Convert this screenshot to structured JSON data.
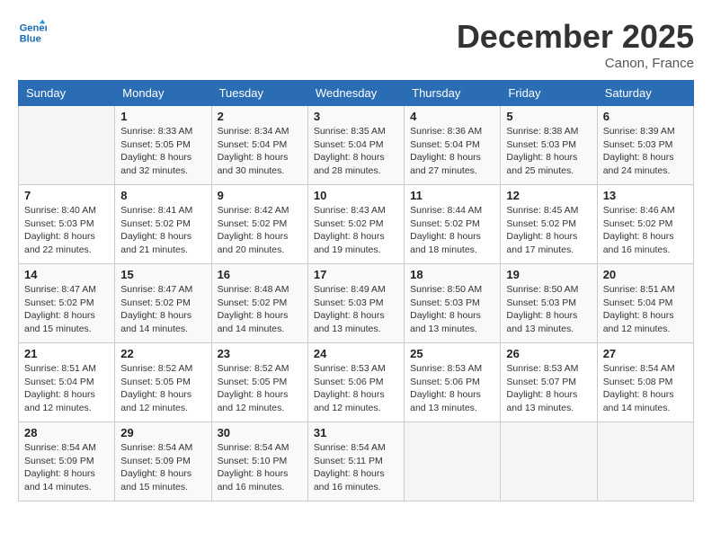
{
  "header": {
    "logo_line1": "General",
    "logo_line2": "Blue",
    "month_year": "December 2025",
    "location": "Canon, France"
  },
  "weekdays": [
    "Sunday",
    "Monday",
    "Tuesday",
    "Wednesday",
    "Thursday",
    "Friday",
    "Saturday"
  ],
  "weeks": [
    [
      {
        "day": "",
        "info": ""
      },
      {
        "day": "1",
        "info": "Sunrise: 8:33 AM\nSunset: 5:05 PM\nDaylight: 8 hours\nand 32 minutes."
      },
      {
        "day": "2",
        "info": "Sunrise: 8:34 AM\nSunset: 5:04 PM\nDaylight: 8 hours\nand 30 minutes."
      },
      {
        "day": "3",
        "info": "Sunrise: 8:35 AM\nSunset: 5:04 PM\nDaylight: 8 hours\nand 28 minutes."
      },
      {
        "day": "4",
        "info": "Sunrise: 8:36 AM\nSunset: 5:04 PM\nDaylight: 8 hours\nand 27 minutes."
      },
      {
        "day": "5",
        "info": "Sunrise: 8:38 AM\nSunset: 5:03 PM\nDaylight: 8 hours\nand 25 minutes."
      },
      {
        "day": "6",
        "info": "Sunrise: 8:39 AM\nSunset: 5:03 PM\nDaylight: 8 hours\nand 24 minutes."
      }
    ],
    [
      {
        "day": "7",
        "info": "Sunrise: 8:40 AM\nSunset: 5:03 PM\nDaylight: 8 hours\nand 22 minutes."
      },
      {
        "day": "8",
        "info": "Sunrise: 8:41 AM\nSunset: 5:02 PM\nDaylight: 8 hours\nand 21 minutes."
      },
      {
        "day": "9",
        "info": "Sunrise: 8:42 AM\nSunset: 5:02 PM\nDaylight: 8 hours\nand 20 minutes."
      },
      {
        "day": "10",
        "info": "Sunrise: 8:43 AM\nSunset: 5:02 PM\nDaylight: 8 hours\nand 19 minutes."
      },
      {
        "day": "11",
        "info": "Sunrise: 8:44 AM\nSunset: 5:02 PM\nDaylight: 8 hours\nand 18 minutes."
      },
      {
        "day": "12",
        "info": "Sunrise: 8:45 AM\nSunset: 5:02 PM\nDaylight: 8 hours\nand 17 minutes."
      },
      {
        "day": "13",
        "info": "Sunrise: 8:46 AM\nSunset: 5:02 PM\nDaylight: 8 hours\nand 16 minutes."
      }
    ],
    [
      {
        "day": "14",
        "info": "Sunrise: 8:47 AM\nSunset: 5:02 PM\nDaylight: 8 hours\nand 15 minutes."
      },
      {
        "day": "15",
        "info": "Sunrise: 8:47 AM\nSunset: 5:02 PM\nDaylight: 8 hours\nand 14 minutes."
      },
      {
        "day": "16",
        "info": "Sunrise: 8:48 AM\nSunset: 5:02 PM\nDaylight: 8 hours\nand 14 minutes."
      },
      {
        "day": "17",
        "info": "Sunrise: 8:49 AM\nSunset: 5:03 PM\nDaylight: 8 hours\nand 13 minutes."
      },
      {
        "day": "18",
        "info": "Sunrise: 8:50 AM\nSunset: 5:03 PM\nDaylight: 8 hours\nand 13 minutes."
      },
      {
        "day": "19",
        "info": "Sunrise: 8:50 AM\nSunset: 5:03 PM\nDaylight: 8 hours\nand 13 minutes."
      },
      {
        "day": "20",
        "info": "Sunrise: 8:51 AM\nSunset: 5:04 PM\nDaylight: 8 hours\nand 12 minutes."
      }
    ],
    [
      {
        "day": "21",
        "info": "Sunrise: 8:51 AM\nSunset: 5:04 PM\nDaylight: 8 hours\nand 12 minutes."
      },
      {
        "day": "22",
        "info": "Sunrise: 8:52 AM\nSunset: 5:05 PM\nDaylight: 8 hours\nand 12 minutes."
      },
      {
        "day": "23",
        "info": "Sunrise: 8:52 AM\nSunset: 5:05 PM\nDaylight: 8 hours\nand 12 minutes."
      },
      {
        "day": "24",
        "info": "Sunrise: 8:53 AM\nSunset: 5:06 PM\nDaylight: 8 hours\nand 12 minutes."
      },
      {
        "day": "25",
        "info": "Sunrise: 8:53 AM\nSunset: 5:06 PM\nDaylight: 8 hours\nand 13 minutes."
      },
      {
        "day": "26",
        "info": "Sunrise: 8:53 AM\nSunset: 5:07 PM\nDaylight: 8 hours\nand 13 minutes."
      },
      {
        "day": "27",
        "info": "Sunrise: 8:54 AM\nSunset: 5:08 PM\nDaylight: 8 hours\nand 14 minutes."
      }
    ],
    [
      {
        "day": "28",
        "info": "Sunrise: 8:54 AM\nSunset: 5:09 PM\nDaylight: 8 hours\nand 14 minutes."
      },
      {
        "day": "29",
        "info": "Sunrise: 8:54 AM\nSunset: 5:09 PM\nDaylight: 8 hours\nand 15 minutes."
      },
      {
        "day": "30",
        "info": "Sunrise: 8:54 AM\nSunset: 5:10 PM\nDaylight: 8 hours\nand 16 minutes."
      },
      {
        "day": "31",
        "info": "Sunrise: 8:54 AM\nSunset: 5:11 PM\nDaylight: 8 hours\nand 16 minutes."
      },
      {
        "day": "",
        "info": ""
      },
      {
        "day": "",
        "info": ""
      },
      {
        "day": "",
        "info": ""
      }
    ]
  ]
}
